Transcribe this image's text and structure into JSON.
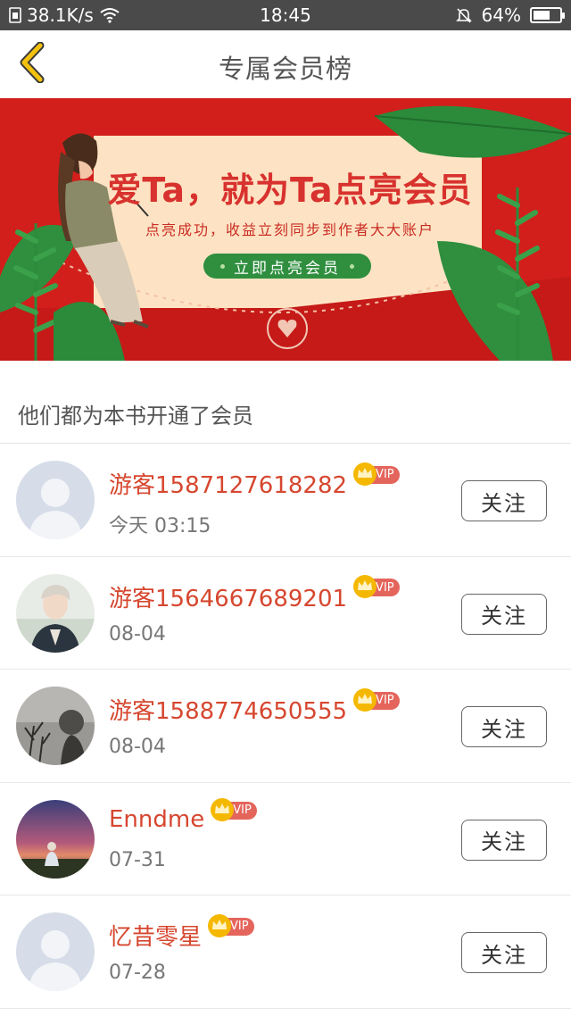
{
  "status_bar": {
    "network_speed": "38.1K/s",
    "time": "18:45",
    "battery": "64%",
    "battery_level": 0.64,
    "icons": [
      "sim-icon",
      "wifi-icon",
      "mute-bell-icon",
      "battery-icon"
    ]
  },
  "header": {
    "title": "专属会员榜",
    "back_icon": "chevron-left-icon",
    "back_color": "#f4c20d"
  },
  "banner": {
    "title": "爱Ta，就为Ta点亮会员",
    "subtitle": "点亮成功，收益立刻同步到作者大大账户",
    "button_label": "立即点亮会员",
    "background_color": "#d21f1b",
    "accent_color": "#2f8f3f"
  },
  "section": {
    "title": "他们都为本书开通了会员"
  },
  "members": [
    {
      "name": "游客1587127618282",
      "time": "今天 03:15",
      "vip_label": "VIP",
      "follow_label": "关注",
      "avatar": "default-avatar"
    },
    {
      "name": "游客1564667689201",
      "time": "08-04",
      "vip_label": "VIP",
      "follow_label": "关注",
      "avatar": "photo-avatar-person"
    },
    {
      "name": "游客1588774650555",
      "time": "08-04",
      "vip_label": "VIP",
      "follow_label": "关注",
      "avatar": "photo-avatar-plants"
    },
    {
      "name": "Enndme",
      "time": "07-31",
      "vip_label": "VIP",
      "follow_label": "关注",
      "avatar": "photo-avatar-sunset"
    },
    {
      "name": "忆昔零星",
      "time": "07-28",
      "vip_label": "VIP",
      "follow_label": "关注",
      "avatar": "default-avatar"
    }
  ],
  "colors": {
    "name_red": "#d6472f",
    "vip_badge": "#e4655c",
    "crown_gold": "#f5b800"
  }
}
